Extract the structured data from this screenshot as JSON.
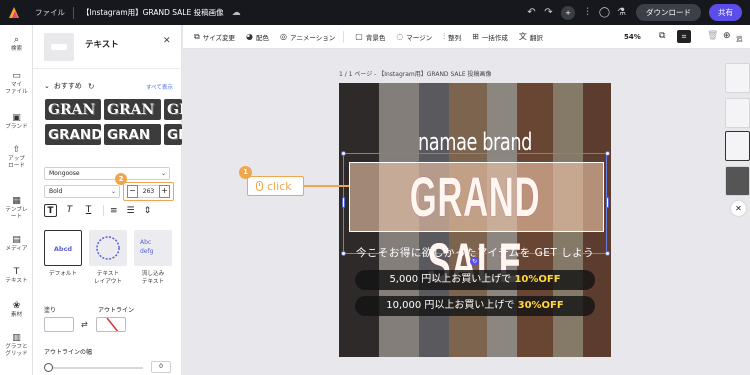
{
  "topbar": {
    "menu_file": "ファイル",
    "doc_title": "【Instagram用】GRAND SALE 投稿画像",
    "download_label": "ダウンロード",
    "share_label": "共有",
    "avatar_initial": "+"
  },
  "rail": [
    {
      "label": "検索",
      "icon": "search-icon"
    },
    {
      "label": "マイ\nファイル",
      "icon": "folder-icon"
    },
    {
      "label": "ブランド",
      "icon": "brand-icon"
    },
    {
      "label": "アップ\nロード",
      "icon": "upload-icon"
    },
    {
      "label": "テンプレ\nート",
      "icon": "template-icon"
    },
    {
      "label": "メディア",
      "icon": "media-icon"
    },
    {
      "label": "テキスト",
      "icon": "text-icon"
    },
    {
      "label": "素材",
      "icon": "elements-icon"
    },
    {
      "label": "グラフと\nグリッド",
      "icon": "chart-icon"
    }
  ],
  "panel": {
    "title": "テキスト",
    "recommended": "おすすめ",
    "see_all": "すべて表示",
    "tiles": [
      "GRAN",
      "GRAN",
      "GRA",
      "GRAND",
      "GRAN",
      "GR"
    ],
    "font_name": "Mongoose",
    "font_weight": "Bold",
    "font_size": "263",
    "layout_default": "デフォルト",
    "layout_text": "テキスト\nレイアウト",
    "layout_flow": "流し込み\nテキスト",
    "card_default_sample": "Abcd",
    "card_flow_sample": "Abc\ndefg",
    "fill_label": "塗り",
    "outline_label": "アウトライン",
    "outline_width_label": "アウトラインの幅",
    "outline_width_value": "0",
    "step2": "2"
  },
  "toolbar": {
    "items": [
      "サイズ変更",
      "配色",
      "アニメーション",
      "背景色",
      "マージン",
      "整列",
      "一括作成",
      "翻訳"
    ],
    "zoom": "54%",
    "add_label": "追"
  },
  "canvas": {
    "page_label": "1 / 1 ページ - 【Instagram用】GRAND SALE 投稿画像",
    "brand": "namae brand",
    "headline": "GRAND SALE",
    "subcopy": "今こそお得に欲しかったアイテムを GET しよう",
    "offer1_pre": "5,000 円以上お買い上げで ",
    "offer1_hl": "10%OFF",
    "offer2_pre": "10,000 円以上お買い上げで ",
    "offer2_hl": "30%OFF"
  },
  "callout": {
    "step": "1",
    "text": "click"
  },
  "colors": {
    "accent": "#5b4ee8",
    "annotation": "#f0a64e",
    "discount": "#ffd93b"
  }
}
